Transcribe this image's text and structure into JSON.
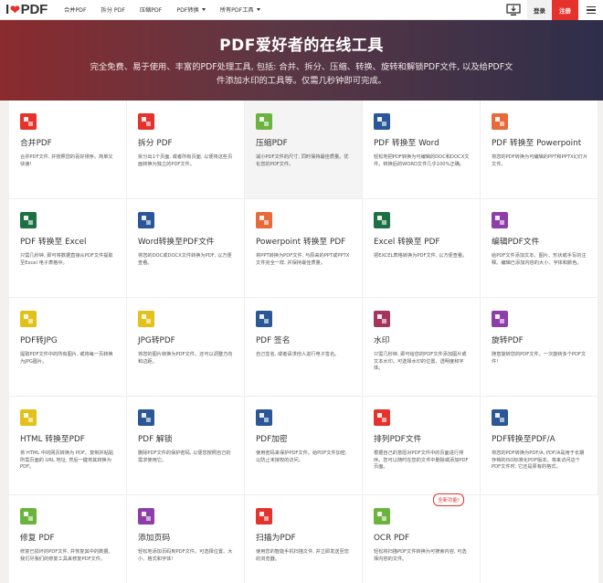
{
  "header": {
    "logo_i": "I",
    "logo_pdf": "PDF",
    "nav": [
      {
        "label": "合并PDF",
        "dropdown": false
      },
      {
        "label": "拆分 PDF",
        "dropdown": false
      },
      {
        "label": "压缩PDF",
        "dropdown": false
      },
      {
        "label": "PDF转换",
        "dropdown": true
      },
      {
        "label": "所有PDF工具",
        "dropdown": true
      }
    ],
    "login_label": "登录",
    "signup_label": "注册"
  },
  "hero": {
    "title": "PDF爱好者的在线工具",
    "subtitle": "完全免费、易于使用、丰富的PDF处理工具, 包括: 合并、拆分、压缩、转换、旋转和解锁PDF文件, 以及给PDF文件添加水印的工具等。仅需几秒钟即可完成。"
  },
  "tools": [
    {
      "title": "合并PDF",
      "desc": "合并PDF文件, 并按照您的喜好排序。简单又快速!",
      "icon": "merge-icon",
      "color": "#e5322d"
    },
    {
      "title": "拆分 PDF",
      "desc": "拆分出1个页面, 或者所有页面, 以便将这些页面转换为独立的PDF文件。",
      "icon": "split-icon",
      "color": "#e5322d"
    },
    {
      "title": "压缩PDF",
      "desc": "减小PDF文件的尺寸, 同时保持最佳质量。优化您的PDF文件。",
      "icon": "compress-icon",
      "color": "#6cb33e"
    },
    {
      "title": "PDF 转换至 Word",
      "desc": "轻松地把PDF转换为可编辑的DOC和DOCX文件。转换后的WORD文件几乎100%正确。",
      "icon": "word-icon",
      "color": "#2b579a"
    },
    {
      "title": "PDF 转换至 Powerpoint",
      "desc": "将您的PDF转换为可编辑的PPT和PPTX幻灯片文件。",
      "icon": "powerpoint-icon",
      "color": "#e8693a"
    },
    {
      "title": "PDF 转换至 Excel",
      "desc": "只需几秒钟, 即可将数据直接从PDF文件提取至Excel 电子表格中。",
      "icon": "excel-icon",
      "color": "#1d7044"
    },
    {
      "title": "Word转换至PDF文件",
      "desc": "将您的DOC或DOCX文件转换为PDF, 以方便查看。",
      "icon": "word-to-pdf-icon",
      "color": "#2b579a"
    },
    {
      "title": "Powerpoint 转换至 PDF",
      "desc": "将PPT转换为PDF文件, 与原来的PPT或PPTX文件完全一样, 并保持最佳质量。",
      "icon": "powerpoint-to-pdf-icon",
      "color": "#e8693a"
    },
    {
      "title": "Excel 转换至 PDF",
      "desc": "把EXCEL表格转换为PDF文件, 以方便查看。",
      "icon": "excel-to-pdf-icon",
      "color": "#1d7044"
    },
    {
      "title": "编辑PDF文件",
      "desc": "给PDF文件添加文本、图片、形状或手写的注释。编辑已添加内容的大小、字体和颜色。",
      "icon": "edit-icon",
      "color": "#8e3ea8"
    },
    {
      "title": "PDF转JPG",
      "desc": "提取PDF文件中的所有图片, 或将每一页转换为JPG图片。",
      "icon": "pdf-to-jpg-icon",
      "color": "#e3c11b"
    },
    {
      "title": "JPG转PDF",
      "desc": "将您的图片转换为PDF文件。还可以调整方向和边距。",
      "icon": "jpg-to-pdf-icon",
      "color": "#e3c11b"
    },
    {
      "title": "PDF 签名",
      "desc": "自己签名, 或者请求他人进行电子签名。",
      "icon": "sign-icon",
      "color": "#2b5797"
    },
    {
      "title": "水印",
      "desc": "只需几秒钟, 即可给您的PDF文件添加图片或文本水印。可选择水印的位置、透明度和字体。",
      "icon": "watermark-icon",
      "color": "#a6355e"
    },
    {
      "title": "旋转PDF",
      "desc": "随意旋转您的PDF文件。一次旋转多个PDF文件!",
      "icon": "rotate-icon",
      "color": "#8e3ea8"
    },
    {
      "title": "HTML 转换至PDF",
      "desc": "将 HTML 中的网页转换为 PDF。复制并粘贴所需页面的 URL 地址, 然后一键将其转换为 PDF。",
      "icon": "html-icon",
      "color": "#e3c11b"
    },
    {
      "title": "PDF 解锁",
      "desc": "删除PDF文件的保护密码, 以便您按照自己的需求使用它。",
      "icon": "unlock-icon",
      "color": "#2b5797"
    },
    {
      "title": "PDF加密",
      "desc": "使用密码来保护PDF文件。给PDF文件加密, 以防止未授权的访问。",
      "icon": "protect-icon",
      "color": "#2b5797"
    },
    {
      "title": "排列PDF文件",
      "desc": "根据自己的意愿对PDF文件中的页面进行排序。您可以随时在您的文件中删除或添加PDF页面。",
      "icon": "organize-icon",
      "color": "#e5322d"
    },
    {
      "title": "PDF转换至PDF/A",
      "desc": "将您的PDF转换为PDF/A, PDF/A是用于长期存档的ISO标准化PDF版本。将来访问这个PDF文件时, 它还是原有的格式。",
      "icon": "pdfa-icon",
      "color": "#2b5797"
    },
    {
      "title": "修复 PDF",
      "desc": "修复已损坏的PDF文件, 并恢复其中的数据。我们尽我们的修复工具来修复PDF文件。",
      "icon": "repair-icon",
      "color": "#6cb33e"
    },
    {
      "title": "添加页码",
      "desc": "轻松地添加页码到PDF文件。可选择位置、大小、格式和字体!",
      "icon": "page-numbers-icon",
      "color": "#8e3ea8"
    },
    {
      "title": "扫描为PDF",
      "desc": "使用您的智能手机扫描文件, 并立即发送至您的浏览器。",
      "icon": "scan-icon",
      "color": "#e5322d"
    },
    {
      "title": "OCR PDF",
      "desc": "轻松将扫描PDF文件转换为可搜索内容, 可选择内容的文件。",
      "icon": "ocr-icon",
      "color": "#6cb33e",
      "badge": "全新功能!"
    }
  ]
}
